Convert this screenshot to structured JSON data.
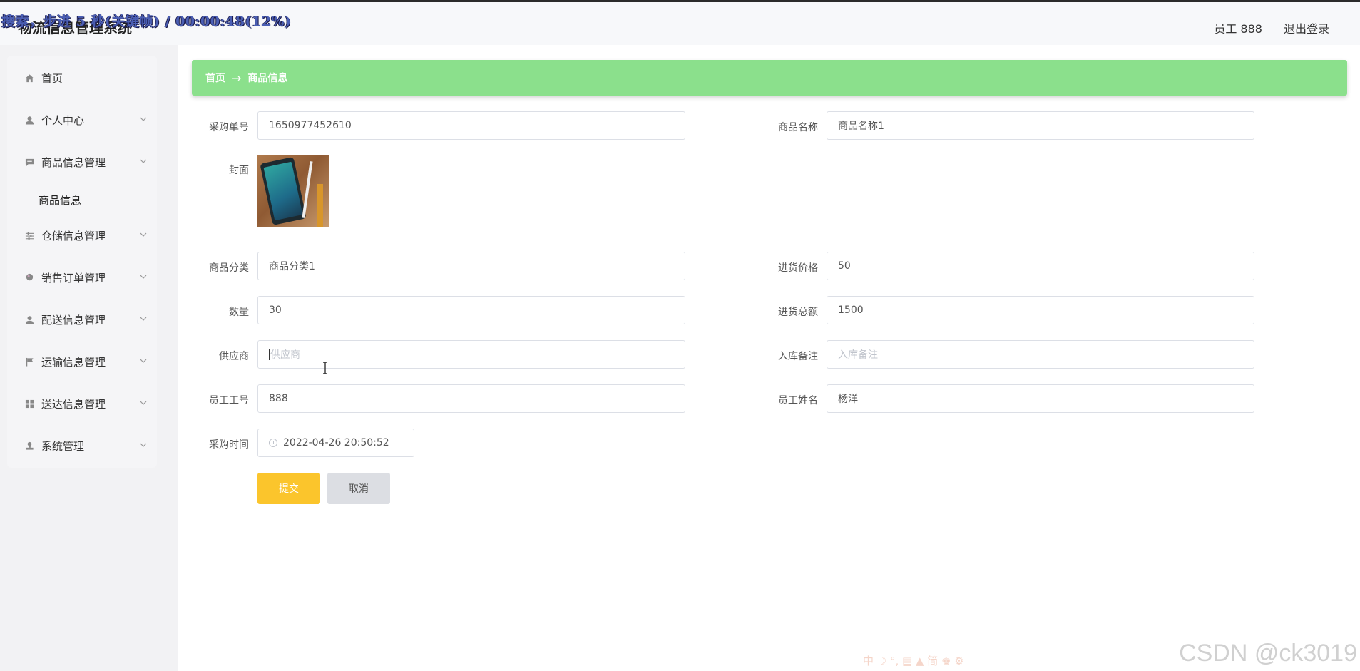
{
  "header": {
    "app_title": "物流信息管理系统",
    "overlay": "搜索，步进 5 秒(关键帧) / 00:00:48(12%)",
    "user": "员工 888",
    "logout": "退出登录"
  },
  "sidebar": {
    "items": [
      {
        "label": "首页",
        "icon": "home-icon"
      },
      {
        "label": "个人中心",
        "icon": "user-icon"
      },
      {
        "label": "商品信息管理",
        "icon": "chat-icon"
      },
      {
        "label": "仓储信息管理",
        "icon": "sliders-icon"
      },
      {
        "label": "销售订单管理",
        "icon": "pin-icon"
      },
      {
        "label": "配送信息管理",
        "icon": "user-icon"
      },
      {
        "label": "运输信息管理",
        "icon": "flag-icon"
      },
      {
        "label": "送达信息管理",
        "icon": "grid-icon"
      },
      {
        "label": "系统管理",
        "icon": "stamp-icon"
      }
    ],
    "sub_item": "商品信息"
  },
  "breadcrumb": {
    "home": "首页",
    "arrow": "→",
    "current": "商品信息"
  },
  "form": {
    "order_no": {
      "label": "采购单号",
      "value": "1650977452610"
    },
    "product_name": {
      "label": "商品名称",
      "value": "商品名称1"
    },
    "cover": {
      "label": "封面"
    },
    "category": {
      "label": "商品分类",
      "value": "商品分类1"
    },
    "purchase_price": {
      "label": "进货价格",
      "value": "50"
    },
    "quantity": {
      "label": "数量",
      "value": "30"
    },
    "total": {
      "label": "进货总额",
      "value": "1500"
    },
    "supplier": {
      "label": "供应商",
      "placeholder": "供应商"
    },
    "remark": {
      "label": "入库备注",
      "placeholder": "入库备注"
    },
    "emp_no": {
      "label": "员工工号",
      "value": "888"
    },
    "emp_name": {
      "label": "员工姓名",
      "value": "杨洋"
    },
    "purchase_time": {
      "label": "采购时间",
      "value": "2022-04-26 20:50:52"
    }
  },
  "buttons": {
    "submit": "提交",
    "cancel": "取消"
  },
  "watermark": "CSDN @ck3019",
  "ime_bar": "中 ☽ °, ▤ ▲ 简 ♚ ⚙",
  "colors": {
    "breadcrumb_bg": "#8be08c",
    "submit_bg": "#fbc52c",
    "cancel_bg": "#dcdee3"
  }
}
